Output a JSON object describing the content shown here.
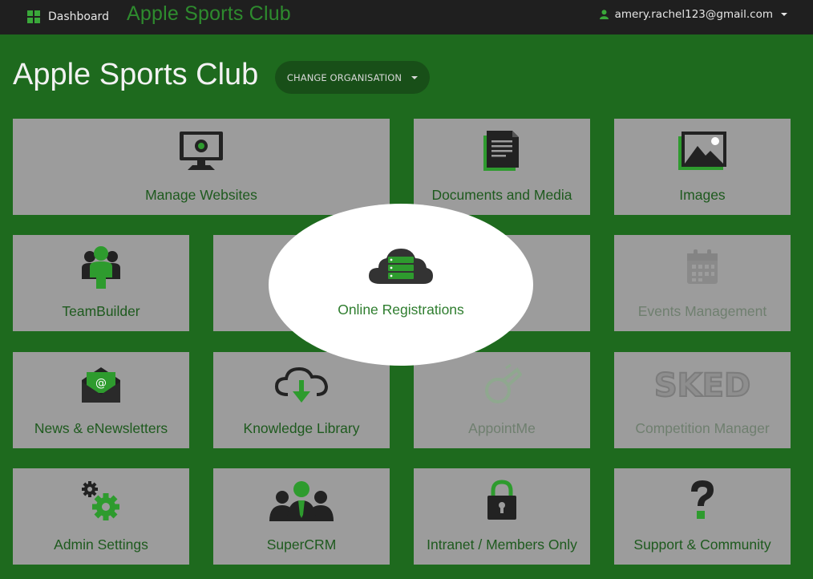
{
  "topbar": {
    "dashboard_label": "Dashboard",
    "brand": "Apple Sports Club",
    "user_email": "amery.rachel123@gmail.com"
  },
  "header": {
    "title": "Apple Sports Club",
    "change_org_label": "CHANGE ORGANISATION"
  },
  "tiles": [
    {
      "label": "Manage Websites",
      "icon": "monitor-icon"
    },
    {
      "label": "Documents and Media",
      "icon": "document-icon"
    },
    {
      "label": "Images",
      "icon": "image-icon"
    },
    {
      "label": "TeamBuilder",
      "icon": "team-icon"
    },
    {
      "label": "Online Registrations",
      "icon": "cloud-server-icon"
    },
    {
      "label": "Events Management",
      "icon": "calendar-icon"
    },
    {
      "label": "News & eNewsletters",
      "icon": "envelope-icon"
    },
    {
      "label": "Knowledge Library",
      "icon": "cloud-download-icon"
    },
    {
      "label": "AppointMe",
      "icon": "whistle-icon"
    },
    {
      "label": "Competition Manager",
      "icon": "sked-logo"
    },
    {
      "label": "Admin Settings",
      "icon": "gears-icon"
    },
    {
      "label": "SuperCRM",
      "icon": "people-icon"
    },
    {
      "label": "Intranet / Members Only",
      "icon": "lock-icon"
    },
    {
      "label": "Support & Community",
      "icon": "question-icon"
    }
  ],
  "logo_texts": {
    "sked": "SKED"
  },
  "colors": {
    "background": "#1e6a1e",
    "tile": "#9c9c9c",
    "accent": "#2e9b2e",
    "topbar": "#1f1f1f"
  }
}
